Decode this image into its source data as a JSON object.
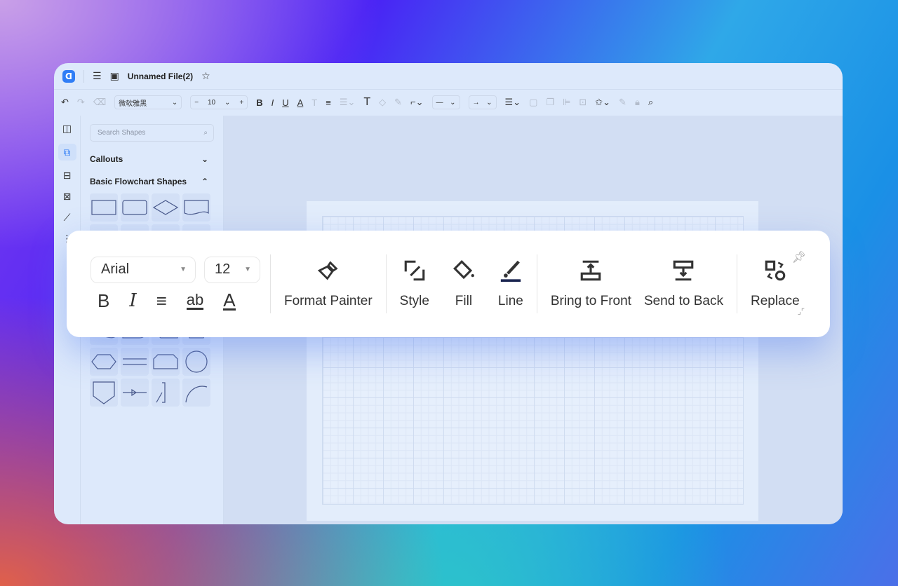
{
  "app": {
    "title": "Unnamed File(2)",
    "logo_letter": "D"
  },
  "toolbar": {
    "font": "微软雅黑",
    "font_size": "10"
  },
  "panel": {
    "search_placeholder": "Search Shapes",
    "sections": [
      {
        "label": "Callouts",
        "expanded": false
      },
      {
        "label": "Basic Flowchart Shapes",
        "expanded": true
      }
    ]
  },
  "floating": {
    "font": "Arial",
    "font_size": "12",
    "buttons": [
      "Format Painter",
      "Style",
      "Fill",
      "Line",
      "Bring to Front",
      "Send to Back",
      "Replace"
    ]
  },
  "colors": {
    "accent": "#2f7df6",
    "canvas": "#d2def3"
  }
}
